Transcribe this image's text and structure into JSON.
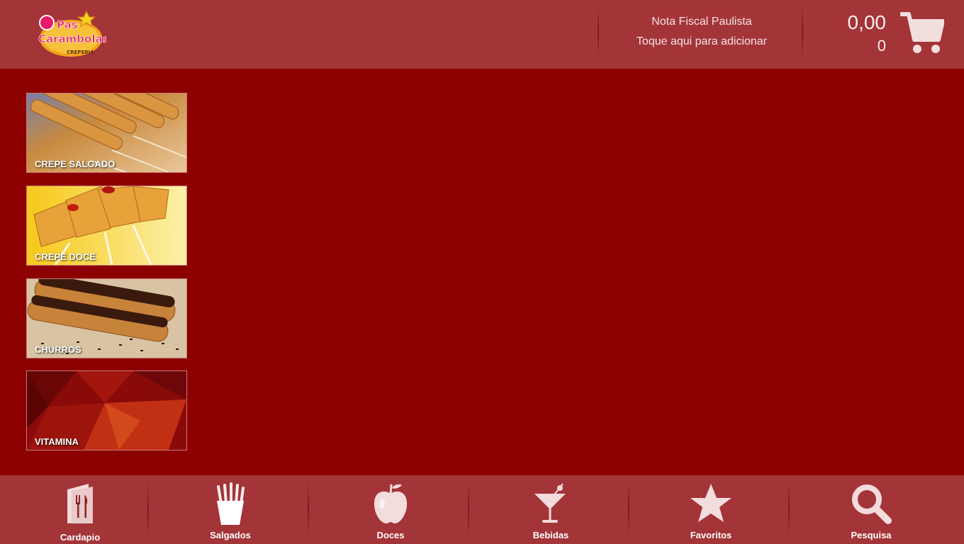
{
  "header": {
    "logo_alt": "Pas Carambolas Creperia",
    "logo_line1": "Pas",
    "logo_line2": "Carambolas",
    "logo_line3": "CREPERIA",
    "nota_title": "Nota Fiscal Paulista",
    "nota_subtitle": "Toque aqui para adicionar",
    "cart_total": "0,00",
    "cart_count": "0",
    "cart_icon": "shopping-cart-icon"
  },
  "categories": [
    {
      "label": "CREPE SALGADO"
    },
    {
      "label": "CREPE DOCE"
    },
    {
      "label": "CHURROS"
    },
    {
      "label": "VITAMINA"
    }
  ],
  "nav": [
    {
      "label": "Cardapio",
      "icon": "menu-card-icon"
    },
    {
      "label": "Salgados",
      "icon": "fries-icon"
    },
    {
      "label": "Doces",
      "icon": "apple-icon"
    },
    {
      "label": "Bebidas",
      "icon": "cocktail-icon"
    },
    {
      "label": "Favoritos",
      "icon": "star-icon"
    },
    {
      "label": "Pesquisa",
      "icon": "search-icon"
    }
  ],
  "colors": {
    "background": "#8d0000",
    "bar": "#a33438",
    "text": "#ffffff"
  }
}
